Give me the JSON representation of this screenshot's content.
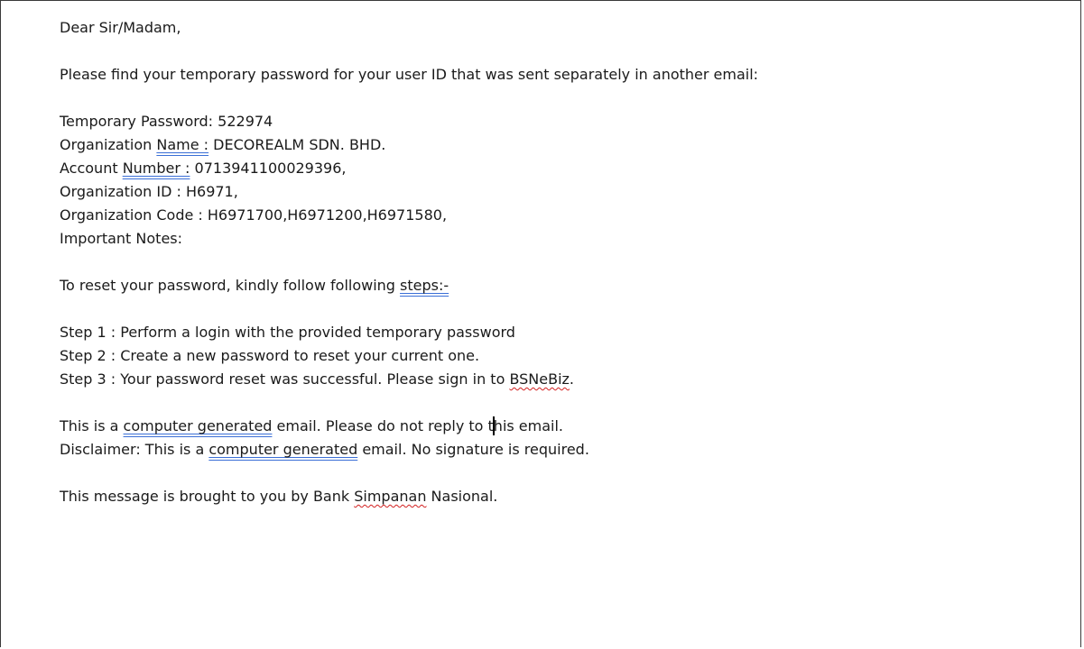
{
  "email": {
    "greeting": "Dear Sir/Madam,",
    "intro": "Please find your temporary password for your user ID that was sent separately in another email:",
    "temp_password_label": "Temporary Password: ",
    "temp_password_value": "522974",
    "org_name_prefix": "Organization ",
    "org_name_label": "Name :",
    "org_name_value": " DECOREALM SDN. BHD.",
    "account_prefix": "Account ",
    "account_label": "Number :",
    "account_value": " 0713941100029396,",
    "org_id_line": "Organization ID : H6971,",
    "org_code_line": "Organization Code : H6971700,H6971200,H6971580,",
    "important_notes": "Important Notes:",
    "reset_intro_prefix": "To reset your password, kindly follow following ",
    "reset_intro_link": "steps:-",
    "step1": "Step 1 : Perform a login with the provided temporary password",
    "step2": "Step 2 : Create a new password to reset your current one.",
    "step3_prefix": "Step 3 : Your password reset was successful. Please sign in to ",
    "step3_brand": "BSNeBiz",
    "step3_suffix": ".",
    "notice_prefix": "This is a ",
    "notice_mark": "computer generated",
    "notice_mid": " email. Please do not reply to t",
    "notice_end": "his email.",
    "disclaimer_prefix": "Disclaimer: This is a ",
    "disclaimer_mark": "computer generated",
    "disclaimer_suffix": " email. No signature is required.",
    "footer_prefix": "This message is brought to you by Bank ",
    "footer_mark": "Simpanan",
    "footer_suffix": " Nasional."
  },
  "colors": {
    "grammar_underline": "#3b6fd6",
    "spelling_underline": "#d22020"
  }
}
